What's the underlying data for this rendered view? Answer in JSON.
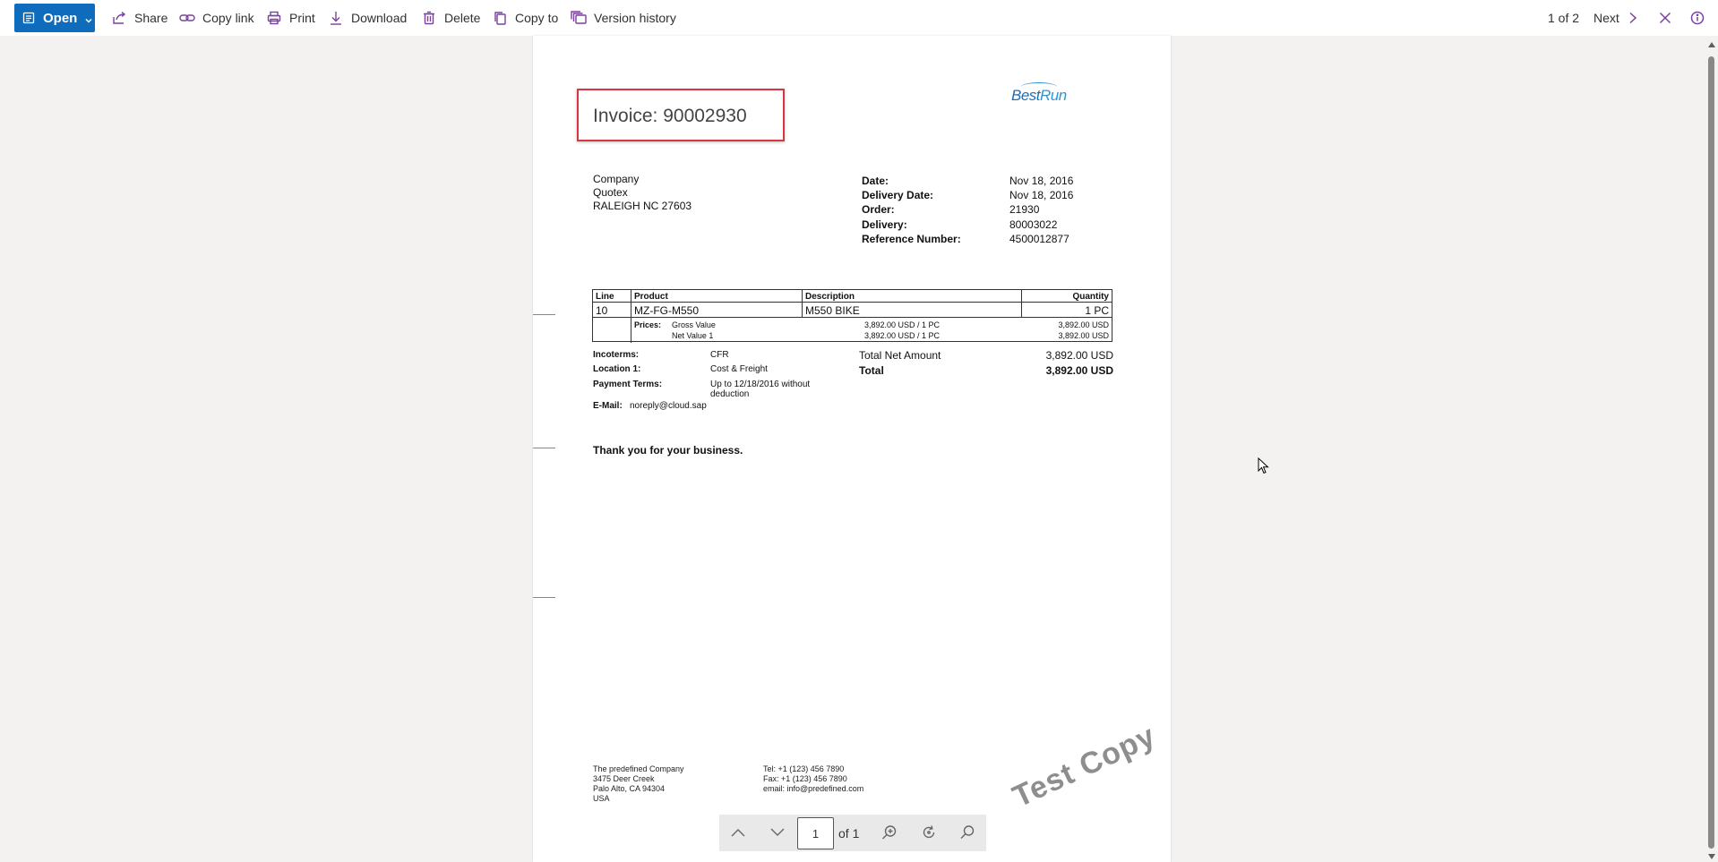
{
  "toolbar": {
    "open_label": "Open",
    "share_label": "Share",
    "copy_link_label": "Copy link",
    "print_label": "Print",
    "download_label": "Download",
    "delete_label": "Delete",
    "copy_to_label": "Copy to",
    "version_history_label": "Version history",
    "pager": "1 of 2",
    "next_label": "Next",
    "accent_color": "#0f6cbd",
    "icon_color": "#7b3fa0"
  },
  "invoice": {
    "title": "Invoice: 90002930",
    "logo_text_1": "Best",
    "logo_text_2": "Run",
    "customer": [
      "Company",
      "Quotex",
      "RALEIGH NC  27603"
    ],
    "meta": [
      {
        "label": "Date:",
        "value": "Nov 18, 2016"
      },
      {
        "label": "Delivery Date:",
        "value": "Nov 18, 2016"
      },
      {
        "label": "Order:",
        "value": "21930"
      },
      {
        "label": "Delivery:",
        "value": "80003022"
      },
      {
        "label": "Reference Number:",
        "value": "4500012877"
      }
    ],
    "table": {
      "headers": [
        "Line",
        "Product",
        "Description",
        "Quantity"
      ],
      "row": {
        "line": "10",
        "product": "MZ-FG-M550",
        "description": "M550 BIKE",
        "quantity": "1 PC"
      },
      "prices_label": "Prices:",
      "gross_label": "Gross Value",
      "gross_unit": "3,892.00 USD / 1 PC",
      "gross_total": "3,892.00 USD",
      "net_label": "Net Value 1",
      "net_unit": "3,892.00 USD / 1 PC",
      "net_total": "3,892.00 USD"
    },
    "incoterms_label": "Incoterms:",
    "incoterms_value": "CFR",
    "location_label": "Location 1:",
    "location_value": "Cost & Freight",
    "payment_label": "Payment Terms:",
    "payment_value_1": "Up to 12/18/2016 without",
    "payment_value_2": "deduction",
    "email_label": "E-Mail:",
    "email_value": "noreply@cloud.sap",
    "total_net_label": "Total Net Amount",
    "total_net_value": "3,892.00 USD",
    "total_label": "Total",
    "total_value": "3,892.00 USD",
    "thanks": "Thank you for your business.",
    "footer_left": [
      "The predefined Company",
      "3475 Deer Creek",
      "Palo Alto, CA 94304",
      "USA"
    ],
    "footer_right": [
      "Tel: +1 (123) 456 7890",
      "Fax: +1 (123) 456 7890",
      "email: info@predefined.com"
    ],
    "watermark": "Test Copy"
  },
  "pdf_toolbar": {
    "page_value": "1",
    "page_of": "of 1"
  }
}
